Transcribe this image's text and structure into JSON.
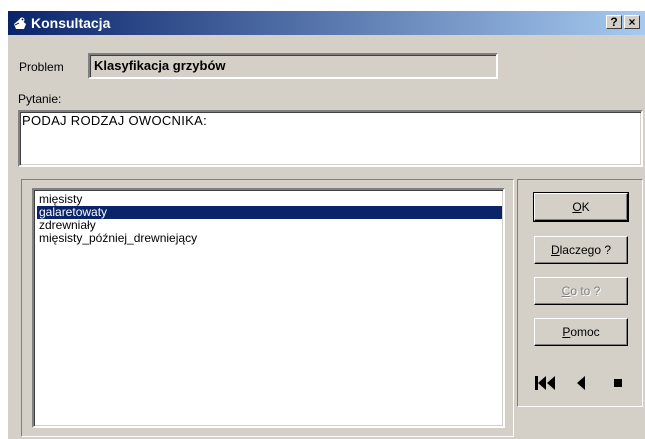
{
  "window": {
    "title": "Konsultacja",
    "help_button": "?",
    "close_button": "×"
  },
  "problem": {
    "label": "Problem",
    "value": "Klasyfikacja grzybów"
  },
  "question": {
    "label": "Pytanie:",
    "text": "PODAJ RODZAJ OWOCNIKA:"
  },
  "answers": {
    "items": [
      "mięsisty",
      "galaretowaty",
      "zdrewniały",
      "mięsisty_później_drewniejący"
    ],
    "selected": "galaretowaty"
  },
  "buttons": {
    "ok_label": "OK",
    "why_label": "Dlaczego ?",
    "what_label": "Co to ?",
    "help_label": "Pomoc"
  },
  "nav_icons": [
    "first-icon",
    "back-icon",
    "stop-icon"
  ]
}
